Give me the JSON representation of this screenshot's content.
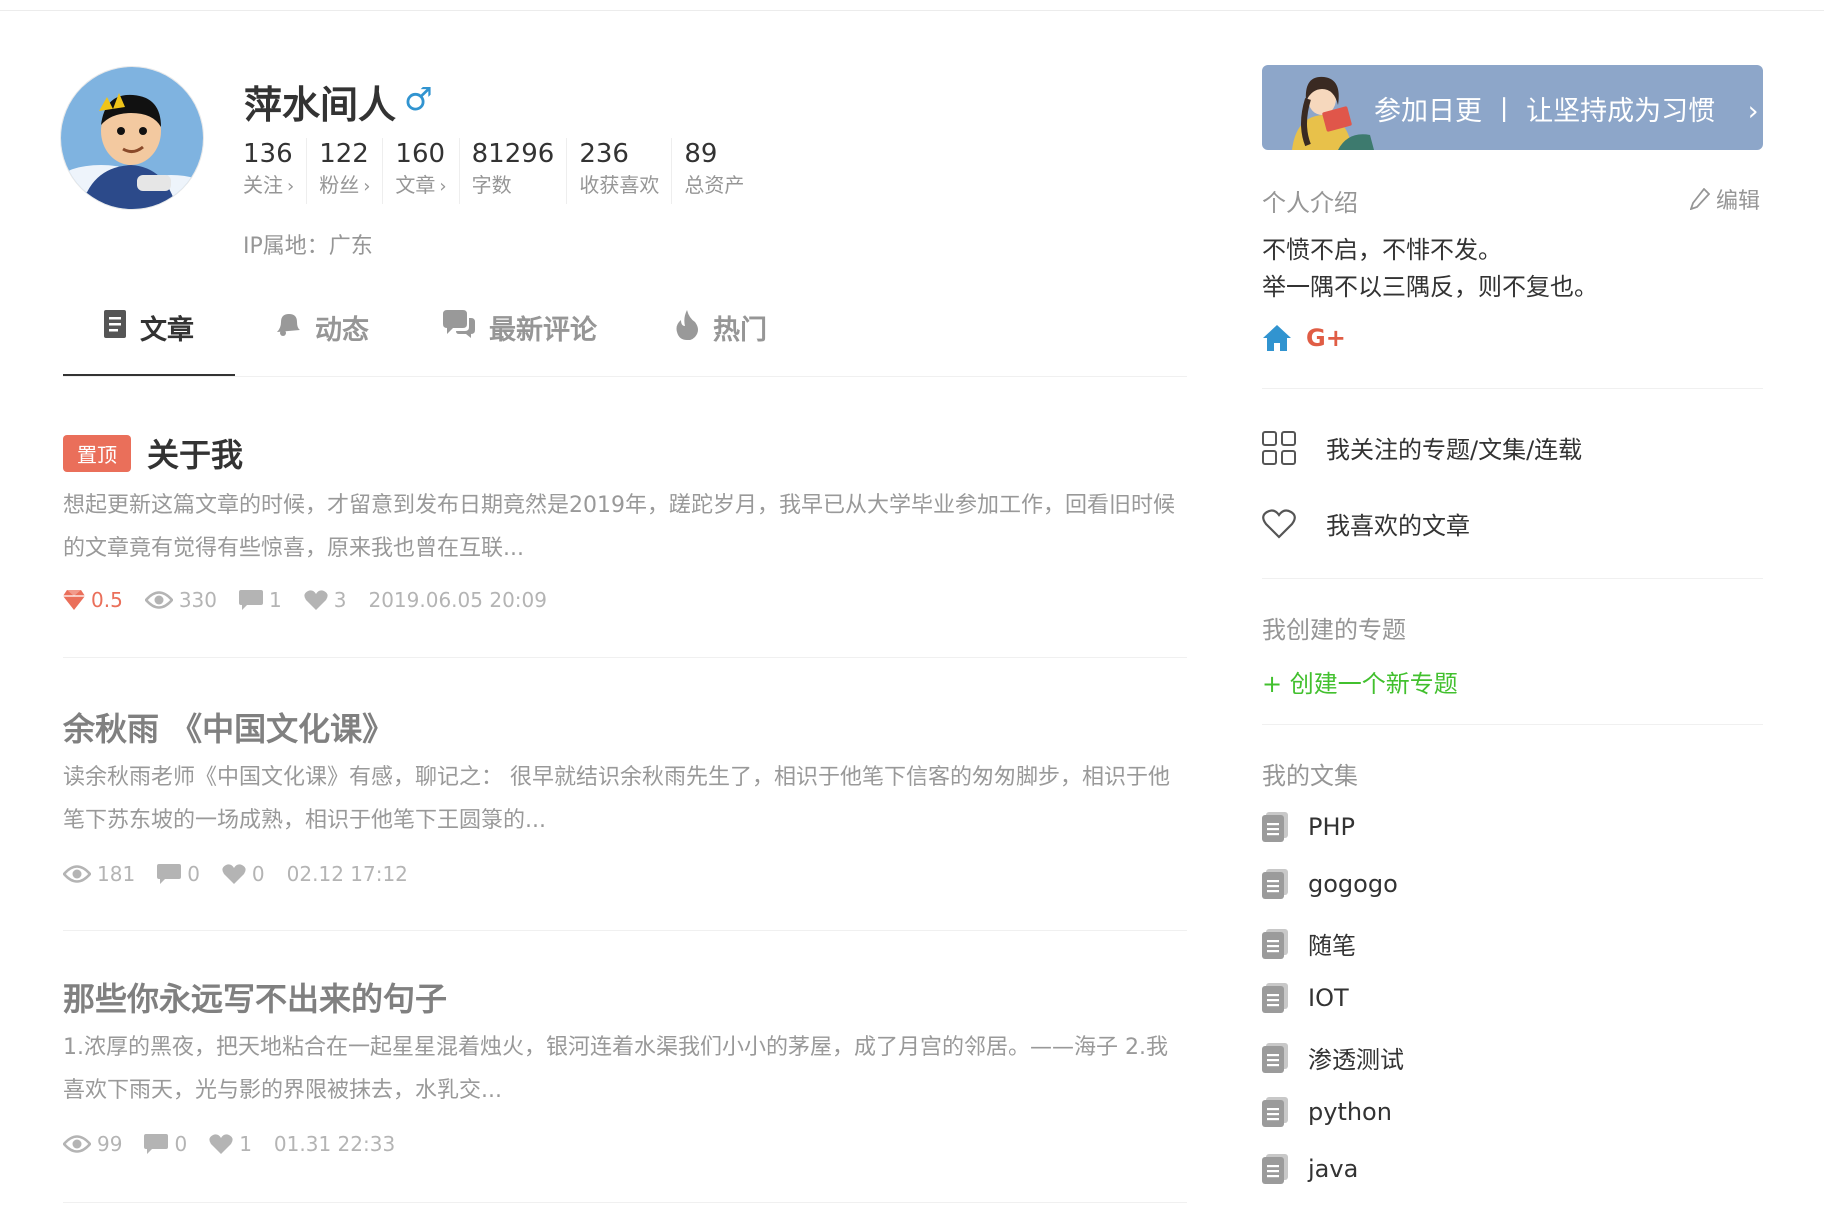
{
  "profile": {
    "name": "萍水间人",
    "gender_icon": "male-icon",
    "stats": [
      {
        "value": "136",
        "label": "关注",
        "link": true
      },
      {
        "value": "122",
        "label": "粉丝",
        "link": true
      },
      {
        "value": "160",
        "label": "文章",
        "link": true
      },
      {
        "value": "81296",
        "label": "字数",
        "link": false
      },
      {
        "value": "236",
        "label": "收获喜欢",
        "link": false
      },
      {
        "value": "89",
        "label": "总资产",
        "link": false
      }
    ],
    "ip": "IP属地：广东"
  },
  "tabs": [
    {
      "label": "文章",
      "icon": "document-icon",
      "active": true
    },
    {
      "label": "动态",
      "icon": "bell-icon",
      "active": false
    },
    {
      "label": "最新评论",
      "icon": "comments-icon",
      "active": false
    },
    {
      "label": "热门",
      "icon": "fire-icon",
      "active": false
    }
  ],
  "articles": [
    {
      "pinned": true,
      "pin_label": "置顶",
      "title": "关于我",
      "abstract": "想起更新这篇文章的时候，才留意到发布日期竟然是2019年，蹉跎岁月，我早已从大学毕业参加工作，回看旧时候的文章竟有觉得有些惊喜，原来我也曾在互联...",
      "diamond": "0.5",
      "views": "330",
      "comments": "1",
      "likes": "3",
      "time": "2019.06.05 20:09"
    },
    {
      "pinned": false,
      "title": "余秋雨 《中国文化课》",
      "abstract": "读余秋雨老师《中国文化课》有感，聊记之： 很早就结识余秋雨先生了，相识于他笔下信客的匆匆脚步，相识于他笔下苏东坡的一场成熟，相识于他笔下王圆箓的...",
      "views": "181",
      "comments": "0",
      "likes": "0",
      "time": "02.12 17:12"
    },
    {
      "pinned": false,
      "title": "那些你永远写不出来的句子",
      "abstract": "1.浓厚的黑夜，把天地粘合在一起星星混着烛火，银河连着水渠我们小小的茅屋，成了月宫的邻居。——海子 2.我喜欢下雨天，光与影的界限被抹去，水乳交...",
      "views": "99",
      "comments": "0",
      "likes": "1",
      "time": "01.31 22:33"
    }
  ],
  "sidebar": {
    "banner": "参加日更 丨 让坚持成为习惯",
    "intro_heading": "个人介绍",
    "edit_label": "编辑",
    "intro_lines": [
      "不愤不启，不悱不发。",
      "举一隅不以三隅反，则不复也。"
    ],
    "social_icons": [
      "home-icon",
      "google-plus-icon"
    ],
    "links": [
      {
        "label": "我关注的专题/文集/连载",
        "icon": "grid-icon"
      },
      {
        "label": "我喜欢的文章",
        "icon": "heart-icon"
      }
    ],
    "collections_heading": "我创建的专题",
    "create_collection": "+ 创建一个新专题",
    "notebooks_heading": "我的文集",
    "notebooks": [
      "PHP",
      "gogogo",
      "随笔",
      "IOT",
      "渗透测试",
      "python",
      "java"
    ]
  },
  "colors": {
    "accent_red": "#ea6f5a",
    "accent_green": "#42c02e",
    "gender_blue": "#3194d0",
    "banner_bg": "#8da6c9"
  }
}
